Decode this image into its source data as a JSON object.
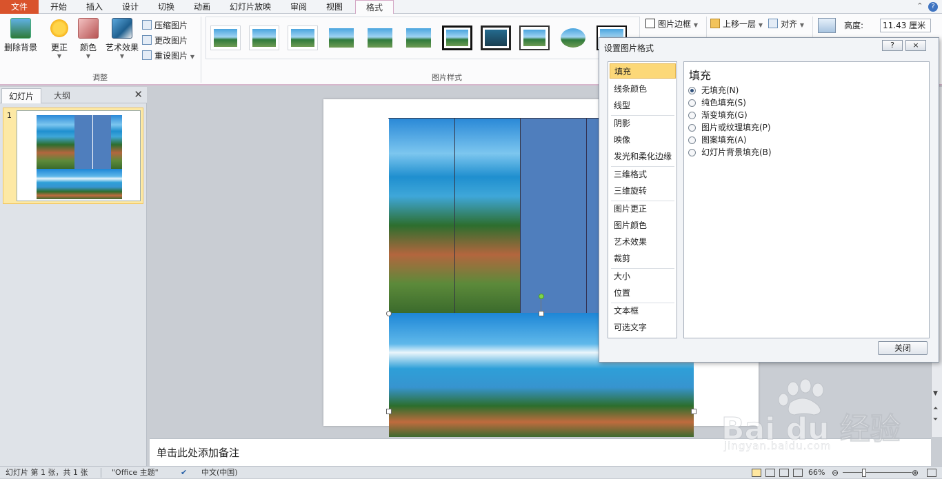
{
  "tabs": {
    "file": "文件",
    "items": [
      "开始",
      "插入",
      "设计",
      "切换",
      "动画",
      "幻灯片放映",
      "审阅",
      "视图"
    ],
    "format": "格式"
  },
  "ribbon": {
    "adjust": {
      "remove_bg": "删除背景",
      "corrections": "更正",
      "color": "颜色",
      "artistic": "艺术效果",
      "compress": "压缩图片",
      "change": "更改图片",
      "reset": "重设图片",
      "label": "调整"
    },
    "styles_label": "图片样式",
    "border": "图片边框",
    "bring_forward": "上移一层",
    "align": "对齐",
    "height_label": "高度:",
    "height_value": "11.43 厘米"
  },
  "left_pane": {
    "tab_slides": "幻灯片",
    "tab_outline": "大纲",
    "slide_number": "1"
  },
  "notes": "单击此处添加备注",
  "status": {
    "slide_info": "幻灯片 第 1 张，共 1 张",
    "theme": "\"Office 主题\"",
    "language": "中文(中国)",
    "zoom": "66%"
  },
  "dialog": {
    "title": "设置图片格式",
    "help": "?",
    "close_x": "×",
    "nav": [
      "填充",
      "线条颜色",
      "线型",
      "阴影",
      "映像",
      "发光和柔化边缘",
      "三维格式",
      "三维旋转",
      "图片更正",
      "图片颜色",
      "艺术效果",
      "裁剪",
      "大小",
      "位置",
      "文本框",
      "可选文字"
    ],
    "panel_title": "填充",
    "options": [
      "无填充(N)",
      "纯色填充(S)",
      "渐变填充(G)",
      "图片或纹理填充(P)",
      "图案填充(A)",
      "幻灯片背景填充(B)"
    ],
    "close_button": "关闭"
  },
  "watermark": {
    "brand": "Bai du 经验",
    "url": "jingyan.baidu.com"
  },
  "colors": {
    "file_tab": "#d9532c",
    "selection": "#fcd878",
    "shape_blue": "#4f7ebd"
  }
}
